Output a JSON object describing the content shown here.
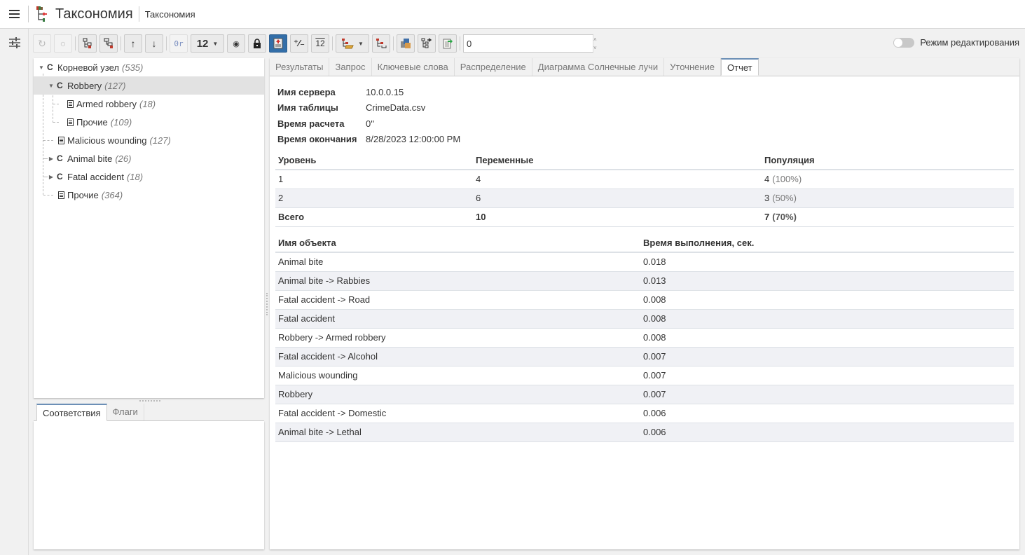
{
  "header": {
    "app_title": "Таксономия",
    "breadcrumb": "Таксономия"
  },
  "toolbar": {
    "level_value": "12",
    "number_input_value": "0",
    "buttons": [
      {
        "name": "refresh",
        "icon": "refresh-icon"
      },
      {
        "name": "reset",
        "icon": "reset-icon"
      },
      {
        "name": "expand-tree",
        "icon": "tree-expand-icon"
      },
      {
        "name": "collapse-tree",
        "icon": "tree-collapse-icon"
      },
      {
        "name": "move-up",
        "icon": "arrow-up-icon"
      },
      {
        "name": "move-down",
        "icon": "arrow-down-icon"
      },
      {
        "name": "or-operator",
        "icon": "or-icon"
      },
      {
        "name": "view",
        "icon": "eye-icon"
      },
      {
        "name": "lock",
        "icon": "lock-icon"
      },
      {
        "name": "report",
        "icon": "report-icon"
      },
      {
        "name": "percent",
        "icon": "percent-icon"
      },
      {
        "name": "number-format",
        "icon": "numbers-icon"
      },
      {
        "name": "open-taxonomy",
        "icon": "folder-tree-icon"
      },
      {
        "name": "tree-settings",
        "icon": "tree-settings-icon"
      },
      {
        "name": "cubes",
        "icon": "cubes-icon"
      },
      {
        "name": "export-tree",
        "icon": "export-tree-icon"
      },
      {
        "name": "export-document",
        "icon": "export-document-icon"
      }
    ],
    "edit_mode_label": "Режим редактирования",
    "edit_mode_on": false
  },
  "tree": {
    "nodes": [
      {
        "label": "Корневой узел",
        "count": "(535)",
        "type": "class",
        "depth": 0,
        "expanded": true
      },
      {
        "label": "Robbery",
        "count": "(127)",
        "type": "class",
        "depth": 1,
        "expanded": true,
        "selected": true
      },
      {
        "label": "Armed robbery",
        "count": "(18)",
        "type": "doc",
        "depth": 2
      },
      {
        "label": "Прочие",
        "count": "(109)",
        "type": "doc",
        "depth": 2
      },
      {
        "label": "Malicious wounding",
        "count": "(127)",
        "type": "doc",
        "depth": 1
      },
      {
        "label": "Animal bite",
        "count": "(26)",
        "type": "class",
        "depth": 1,
        "expanded": false
      },
      {
        "label": "Fatal accident",
        "count": "(18)",
        "type": "class",
        "depth": 1,
        "expanded": false
      },
      {
        "label": "Прочие",
        "count": "(364)",
        "type": "doc",
        "depth": 1
      }
    ]
  },
  "bottom_tabs": [
    {
      "label": "Соответствия",
      "active": true
    },
    {
      "label": "Флаги",
      "active": false
    }
  ],
  "main_tabs": [
    {
      "label": "Результаты",
      "active": false
    },
    {
      "label": "Запрос",
      "active": false
    },
    {
      "label": "Ключевые слова",
      "active": false
    },
    {
      "label": "Распределение",
      "active": false
    },
    {
      "label": "Диаграмма Солнечные лучи",
      "active": false
    },
    {
      "label": "Уточнение",
      "active": false
    },
    {
      "label": "Отчет",
      "active": true
    }
  ],
  "report": {
    "info": [
      {
        "key": "Имя сервера",
        "value": "10.0.0.15"
      },
      {
        "key": "Имя таблицы",
        "value": "CrimeData.csv"
      },
      {
        "key": "Время расчета",
        "value": "0''"
      },
      {
        "key": "Время окончания",
        "value": "8/28/2023 12:00:00 PM"
      }
    ],
    "levels_table": {
      "headers": [
        "Уровень",
        "Переменные",
        "Популяция"
      ],
      "rows": [
        {
          "level": "1",
          "variables": "4",
          "population": "4",
          "pct": "(100%)"
        },
        {
          "level": "2",
          "variables": "6",
          "population": "3",
          "pct": "(50%)"
        }
      ],
      "total": {
        "level": "Всего",
        "variables": "10",
        "population": "7",
        "pct": "(70%)"
      }
    },
    "timing_table": {
      "headers": [
        "Имя объекта",
        "Время выполнения, сек."
      ],
      "rows": [
        {
          "name": "Animal bite",
          "time": "0.018"
        },
        {
          "name": "Animal bite -> Rabbies",
          "time": "0.013"
        },
        {
          "name": "Fatal accident -> Road",
          "time": "0.008"
        },
        {
          "name": "Fatal accident",
          "time": "0.008"
        },
        {
          "name": "Robbery -> Armed robbery",
          "time": "0.008"
        },
        {
          "name": "Fatal accident -> Alcohol",
          "time": "0.007"
        },
        {
          "name": "Malicious wounding",
          "time": "0.007"
        },
        {
          "name": "Robbery",
          "time": "0.007"
        },
        {
          "name": "Fatal accident -> Domestic",
          "time": "0.006"
        },
        {
          "name": "Animal bite -> Lethal",
          "time": "0.006"
        }
      ]
    }
  },
  "colors": {
    "accent": "#336ea8",
    "tab_active_border": "#6c8fb6",
    "row_alt": "#f0f1f5",
    "selected_row": "#e2e2e2"
  }
}
